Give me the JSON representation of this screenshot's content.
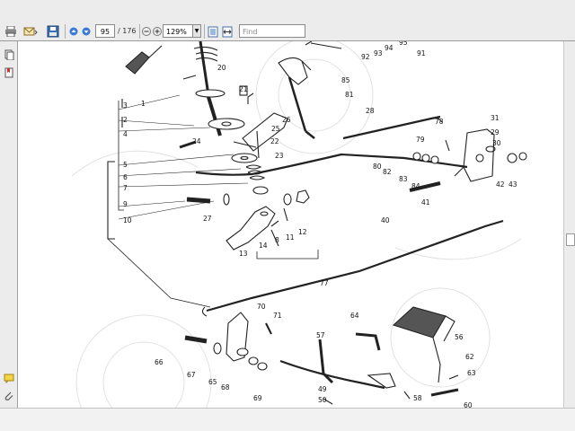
{
  "toolbar": {
    "page_number": "95",
    "page_total": "/ 176",
    "zoom": "129%",
    "find_placeholder": "Find",
    "icons": [
      "print-icon",
      "email-icon",
      "save-icon",
      "previous-page-icon",
      "next-page-icon",
      "zoom-out-icon",
      "zoom-in-icon",
      "fit-page-icon",
      "fit-width-icon"
    ]
  },
  "sidebar": {
    "icons": [
      "pages-icon",
      "bookmarks-icon",
      "comments-icon",
      "attachments-icon"
    ]
  },
  "diagram": {
    "part_labels": [
      "1",
      "2",
      "3",
      "4",
      "5",
      "6",
      "7",
      "8",
      "9",
      "10",
      "11",
      "12",
      "13",
      "14",
      "20",
      "21",
      "22",
      "23",
      "24",
      "25",
      "26",
      "27",
      "28",
      "29",
      "30",
      "31",
      "40",
      "41",
      "42",
      "43",
      "49",
      "50",
      "56",
      "57",
      "58",
      "60",
      "62",
      "63",
      "64",
      "65",
      "66",
      "67",
      "68",
      "69",
      "70",
      "71",
      "77",
      "78",
      "79",
      "80",
      "81",
      "82",
      "83",
      "84",
      "85",
      "91",
      "92",
      "93",
      "94",
      "95"
    ]
  }
}
